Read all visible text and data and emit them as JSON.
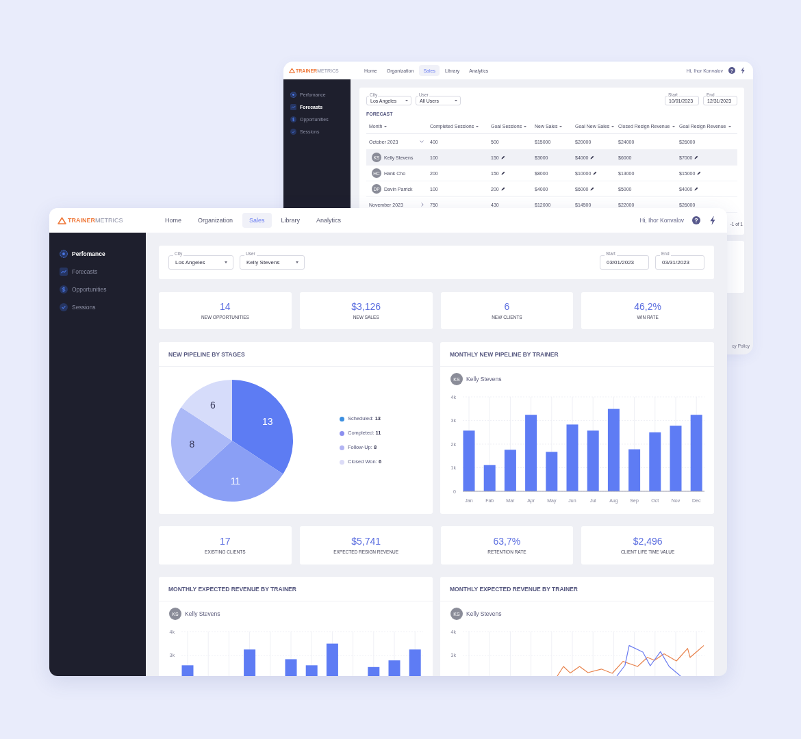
{
  "back_window": {
    "header": {
      "logo": "**TRAINER**METRICS",
      "nav": [
        {
          "label": "Home",
          "selected": false
        },
        {
          "label": "Organization",
          "selected": false
        },
        {
          "label": "Sales",
          "selected": true
        },
        {
          "label": "Library",
          "selected": false
        },
        {
          "label": "Analytics",
          "selected": false
        }
      ],
      "greeting": "Hi, Ihor Konvalov",
      "help": "?"
    },
    "sidebar": {
      "items": [
        {
          "label": "Perfomance",
          "selected": false
        },
        {
          "label": "Forecasts",
          "selected": true
        },
        {
          "label": "Opportunities",
          "selected": false
        },
        {
          "label": "Sessions",
          "selected": false
        }
      ]
    },
    "filters": [
      {
        "label": "City",
        "value": "Los Angeles",
        "kind": "select"
      },
      {
        "label": "User",
        "value": "All Users",
        "kind": "select"
      },
      {
        "label": "Start",
        "value": "10/01/2023",
        "kind": "date"
      },
      {
        "label": "End",
        "value": "12/31/2023",
        "kind": "date"
      }
    ],
    "forecast": {
      "title": "FORECAST",
      "columns": [
        {
          "label": "Month",
          "editable": false
        },
        {
          "label": "Completed Sessions",
          "editable": false
        },
        {
          "label": "Goal Sessions",
          "editable": true
        },
        {
          "label": "New Sales",
          "editable": false
        },
        {
          "label": "Goal New Sales",
          "editable": true
        },
        {
          "label": "Closed Resign Revenue",
          "editable": false
        },
        {
          "label": "Goal Resign Revenue",
          "editable": true
        }
      ],
      "rows": [
        {
          "cells": [
            "October 2023",
            "400",
            "500",
            "$15000",
            "$20000",
            "$24000",
            "$26000"
          ],
          "expanded": true,
          "children": [
            {
              "initials": "KS",
              "cells": [
                "Kelly Stevens",
                "100",
                "150",
                "$3000",
                "$4000",
                "$6000",
                "$7000"
              ],
              "selected": true
            },
            {
              "initials": "HC",
              "cells": [
                "Hank Cho",
                "200",
                "150",
                "$8000",
                "$10000",
                "$13000",
                "$15000"
              ],
              "selected": false
            },
            {
              "initials": "DP",
              "cells": [
                "Davin Parrick",
                "100",
                "200",
                "$4000",
                "$6000",
                "$5000",
                "$4000"
              ],
              "selected": false
            }
          ]
        },
        {
          "cells": [
            "November 2023",
            "750",
            "430",
            "$12000",
            "$14500",
            "$22000",
            "$26000"
          ],
          "expanded": false
        }
      ],
      "pagination": "-1 of 1"
    },
    "footer_link": "cy Policy"
  },
  "front_window": {
    "header": {
      "logo": "**TRAINER**METRICS",
      "nav": [
        {
          "label": "Home",
          "selected": false
        },
        {
          "label": "Organization",
          "selected": false
        },
        {
          "label": "Sales",
          "selected": true
        },
        {
          "label": "Library",
          "selected": false
        },
        {
          "label": "Analytics",
          "selected": false
        }
      ],
      "greeting": "Hi, Ihor Konvalov",
      "help": "?"
    },
    "sidebar": {
      "items": [
        {
          "label": "Perfomance",
          "selected": true
        },
        {
          "label": "Forecasts",
          "selected": false
        },
        {
          "label": "Opportunities",
          "selected": false
        },
        {
          "label": "Sessions",
          "selected": false
        }
      ]
    },
    "filters": [
      {
        "label": "City",
        "value": "Los Angeles",
        "kind": "select"
      },
      {
        "label": "User",
        "value": "Kelly Stevens",
        "kind": "select"
      },
      {
        "label": "Start",
        "value": "03/01/2023",
        "kind": "date"
      },
      {
        "label": "End",
        "value": "03/31/2023",
        "kind": "date"
      }
    ],
    "stats": [
      {
        "value": "14",
        "label": "NEW OPPORTUNITIES"
      },
      {
        "value": "$3,126",
        "label": "NEW SALES"
      },
      {
        "value": "6",
        "label": "NEW CLIENTS"
      },
      {
        "value": "46,2%",
        "label": "WIN RATE"
      }
    ],
    "panels": [
      {
        "title": "NEW PIPELINE BY STAGES",
        "kind": "pie",
        "legend": [
          {
            "text": "Scheduled: **13**",
            "color": "#3c8fe0"
          },
          {
            "text": "Completed: **11**",
            "color": "#8b8fef"
          },
          {
            "text": "Follow-Up: **8**",
            "color": "#b2b4f3"
          },
          {
            "text": "Closed Won: **6**",
            "color": "#dcdcf7"
          }
        ],
        "chart_data": {
          "type": "pie",
          "values": [
            13,
            11,
            8,
            6
          ],
          "colors": [
            "#5d7cf3",
            "#8a9ff5",
            "#abb9f7",
            "#d6dcfa"
          ],
          "data_labels": true
        }
      },
      {
        "title": "MONTHLY NEW PIPELINE BY TRAINER",
        "kind": "bar",
        "trainer": {
          "initials": "KS",
          "name": "Kelly Stevens"
        },
        "chart_data": {
          "type": "bar",
          "categories": [
            "Jan",
            "Fab",
            "Mar",
            "Apr",
            "May",
            "Jun",
            "Jul",
            "Aug",
            "Sep",
            "Oct",
            "Nov",
            "Dec"
          ],
          "series": [
            {
              "color": "#5e7cf4",
              "values": [
                2570,
                1110,
                1760,
                3240,
                1670,
                2830,
                2570,
                3490,
                1780,
                2500,
                2780,
                3240
              ]
            }
          ],
          "ylim": [
            0,
            4000
          ],
          "yticks": [
            {
              "value": 0,
              "label": "0"
            },
            {
              "value": 1000,
              "label": "1k"
            },
            {
              "value": 2000,
              "label": "2k"
            },
            {
              "value": 3000,
              "label": "3k"
            },
            {
              "value": 4000,
              "label": "4k"
            }
          ],
          "grid": true
        }
      }
    ],
    "stats_2": [
      {
        "value": "17",
        "label": "EXISTING CLIENTS"
      },
      {
        "value": "$5,741",
        "label": "EXPECTED RESIGN REVENUE"
      },
      {
        "value": "63,7%",
        "label": "RETENTION RATE"
      },
      {
        "value": "$2,496",
        "label": "CLIENT LIFE TIME VALUE"
      }
    ],
    "panels_2": [
      {
        "title": "MONTHLY EXPECTED REVENUE BY TRAINER",
        "kind": "bar_cut",
        "trainer": {
          "initials": "KS",
          "name": "Kelly Stevens"
        },
        "y_tick_labels": [
          "4k",
          "3k"
        ]
      },
      {
        "title": "MONTHLY EXPECTED REVENUE BY TRAINER",
        "kind": "line_cut",
        "trainer": {
          "initials": "KS",
          "name": "Kelly Stevens"
        },
        "y_tick_labels": [
          "4k",
          "3k"
        ]
      }
    ]
  }
}
